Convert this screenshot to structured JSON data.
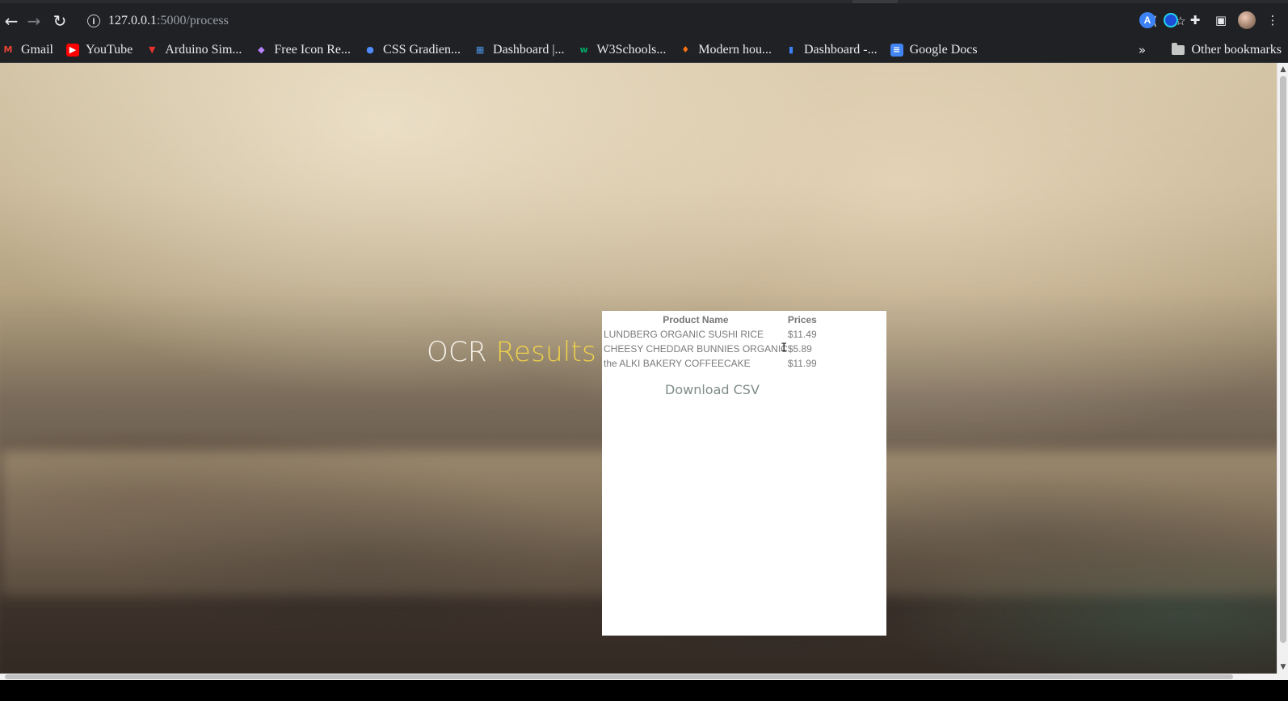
{
  "browser": {
    "url_host": "127.0.0.1",
    "url_path": ":5000/process",
    "bookmarks": [
      {
        "label": "Gmail",
        "icon": "gmail-icon",
        "icon_glyph": "M",
        "icon_color": "#ea4335",
        "icon_bg": "transparent"
      },
      {
        "label": "YouTube",
        "icon": "youtube-icon",
        "icon_glyph": "▶",
        "icon_color": "#ffffff",
        "icon_bg": "#ff0000"
      },
      {
        "label": "Arduino Sim...",
        "icon": "arduino-icon",
        "icon_glyph": "▼",
        "icon_color": "#e5312f",
        "icon_bg": "transparent"
      },
      {
        "label": "Free Icon Re...",
        "icon": "flaticon-icon",
        "icon_glyph": "◆",
        "icon_color": "#b983ff",
        "icon_bg": "transparent"
      },
      {
        "label": "CSS Gradien...",
        "icon": "css-gradient-icon",
        "icon_glyph": "●",
        "icon_color": "#4f8cff",
        "icon_bg": "transparent"
      },
      {
        "label": "Dashboard |...",
        "icon": "dashboard-icon",
        "icon_glyph": "▦",
        "icon_color": "#4a90e2",
        "icon_bg": "transparent"
      },
      {
        "label": "W3Schools...",
        "icon": "w3schools-icon",
        "icon_glyph": "w",
        "icon_color": "#04aa6d",
        "icon_bg": "transparent"
      },
      {
        "label": "Modern hou...",
        "icon": "modern-house-icon",
        "icon_glyph": "♦",
        "icon_color": "#f97316",
        "icon_bg": "transparent"
      },
      {
        "label": "Dashboard -...",
        "icon": "database-icon",
        "icon_glyph": "▮",
        "icon_color": "#3b82f6",
        "icon_bg": "transparent"
      },
      {
        "label": "Google Docs",
        "icon": "google-docs-icon",
        "icon_glyph": "≡",
        "icon_color": "#ffffff",
        "icon_bg": "#4285f4"
      }
    ],
    "overflow_chevron": "»",
    "other_bookmarks": "Other bookmarks"
  },
  "page": {
    "title_main": "OCR ",
    "title_accent": "Results",
    "title_accent_color": "#f0d24a",
    "table_headers": [
      "Product Name",
      "Prices"
    ],
    "rows": [
      [
        "LUNDBERG ORGANIC SUSHI RICE",
        "$11.49"
      ],
      [
        "CHEESY CHEDDAR BUNNIES ORGANIC",
        "$5.89"
      ],
      [
        "the ALKI BAKERY COFFEECAKE",
        "$11.99"
      ]
    ],
    "download_label": "Download CSV"
  }
}
